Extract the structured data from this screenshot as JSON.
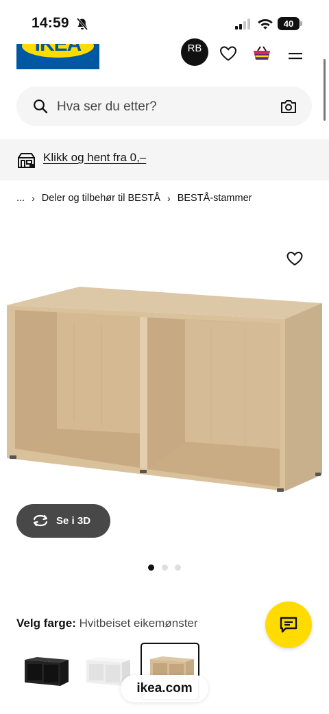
{
  "status_bar": {
    "time": "14:59",
    "battery": "40",
    "icons": [
      "bell-off-icon",
      "signal-icon",
      "wifi-icon",
      "battery-icon"
    ]
  },
  "header": {
    "logo_text": "IKEA",
    "avatar_initials": "RB",
    "icons": [
      "heart-icon",
      "shopping-basket-icon",
      "menu-icon"
    ]
  },
  "search": {
    "placeholder": "Hva ser du etter?",
    "icons": [
      "search-icon",
      "camera-icon"
    ]
  },
  "banner": {
    "link_text": "Klikk og hent fra 0,–",
    "icon": "store-icon"
  },
  "breadcrumb": {
    "items": [
      "...",
      "Deler og tilbehør til BESTÅ",
      "BESTÅ-stammer"
    ],
    "separator": "›"
  },
  "product": {
    "see_3d_label": "Se i 3D",
    "image_dots": 3,
    "active_dot": 1,
    "colour_label": "Velg farge:",
    "colour_value": "Hvitbeiset eikemønster",
    "swatches": [
      {
        "name": "black",
        "color": "#1e1e1e"
      },
      {
        "name": "white",
        "color": "#f2f2f2"
      },
      {
        "name": "white-stained-oak",
        "color": "#c9b08d",
        "selected": true
      }
    ]
  },
  "browser": {
    "url": "ikea.com"
  },
  "colors": {
    "ikea_blue": "#0058a3",
    "ikea_yellow": "#ffdb00",
    "chat_button": "#ffdb00",
    "see_3d_bg": "#484848",
    "banner_bg": "#f5f5f5"
  }
}
